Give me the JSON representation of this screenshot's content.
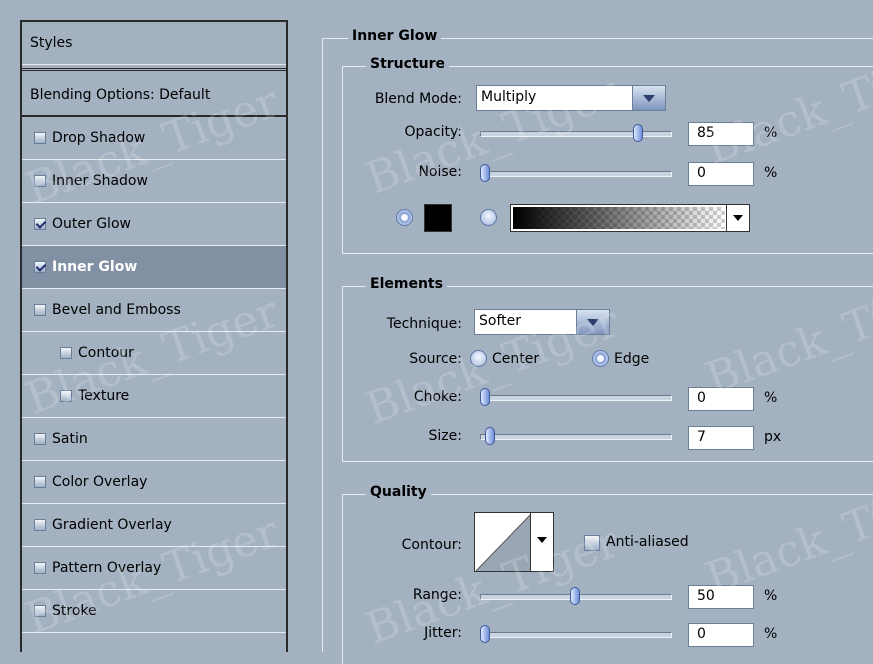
{
  "styles_list": {
    "header": "Styles",
    "blending_options": "Blending Options: Default",
    "items": [
      {
        "label": "Drop Shadow",
        "checked": false
      },
      {
        "label": "Inner Shadow",
        "checked": false
      },
      {
        "label": "Outer Glow",
        "checked": true
      },
      {
        "label": "Inner Glow",
        "checked": true,
        "selected": true
      },
      {
        "label": "Bevel and Emboss",
        "checked": false
      },
      {
        "label": "Contour",
        "checked": false,
        "indent": true
      },
      {
        "label": "Texture",
        "checked": false,
        "indent": true
      },
      {
        "label": "Satin",
        "checked": false
      },
      {
        "label": "Color Overlay",
        "checked": false
      },
      {
        "label": "Gradient Overlay",
        "checked": false
      },
      {
        "label": "Pattern Overlay",
        "checked": false
      },
      {
        "label": "Stroke",
        "checked": false
      }
    ]
  },
  "inner_glow": {
    "title": "Inner Glow",
    "structure": {
      "title": "Structure",
      "blend_mode_label": "Blend Mode:",
      "blend_mode_value": "Multiply",
      "opacity_label": "Opacity:",
      "opacity_value": "85",
      "opacity_unit": "%",
      "opacity_fraction": 0.85,
      "noise_label": "Noise:",
      "noise_value": "0",
      "noise_unit": "%",
      "noise_fraction": 0.0,
      "glow_color": "#000000"
    },
    "elements": {
      "title": "Elements",
      "technique_label": "Technique:",
      "technique_value": "Softer",
      "source_label": "Source:",
      "source_center": "Center",
      "source_edge": "Edge",
      "source_selected": "Edge",
      "choke_label": "Choke:",
      "choke_value": "0",
      "choke_unit": "%",
      "choke_fraction": 0.0,
      "size_label": "Size:",
      "size_value": "7",
      "size_unit": "px",
      "size_fraction": 0.03
    },
    "quality": {
      "title": "Quality",
      "contour_label": "Contour:",
      "anti_aliased_label": "Anti-aliased",
      "anti_aliased_checked": false,
      "range_label": "Range:",
      "range_value": "50",
      "range_unit": "%",
      "range_fraction": 0.5,
      "jitter_label": "Jitter:",
      "jitter_value": "0",
      "jitter_unit": "%",
      "jitter_fraction": 0.0
    }
  },
  "watermark": "Black_Tiger"
}
